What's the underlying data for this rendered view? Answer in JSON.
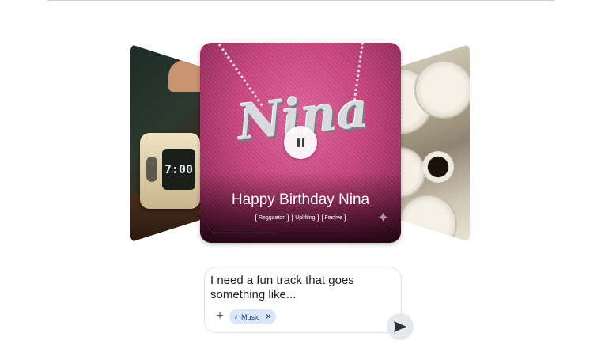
{
  "carousel": {
    "left_card": {
      "clock_display": "7:00"
    },
    "main_card": {
      "pendant_text": "Nina",
      "title": "Happy Birthday Nina",
      "tags": [
        "Reggaeton",
        "Uplifting",
        "Festive"
      ],
      "progress": 0.38
    }
  },
  "prompt": {
    "text": "I need a fun track that goes something like...",
    "chip_label": "Music"
  },
  "colors": {
    "chip_bg": "#d9e6fb",
    "send_bg": "#e5e8ee",
    "card_pink": "#c8457e"
  },
  "icons": [
    "pause-icon",
    "sparkle-icon",
    "add-icon",
    "music-note-icon",
    "close-icon",
    "send-icon"
  ]
}
